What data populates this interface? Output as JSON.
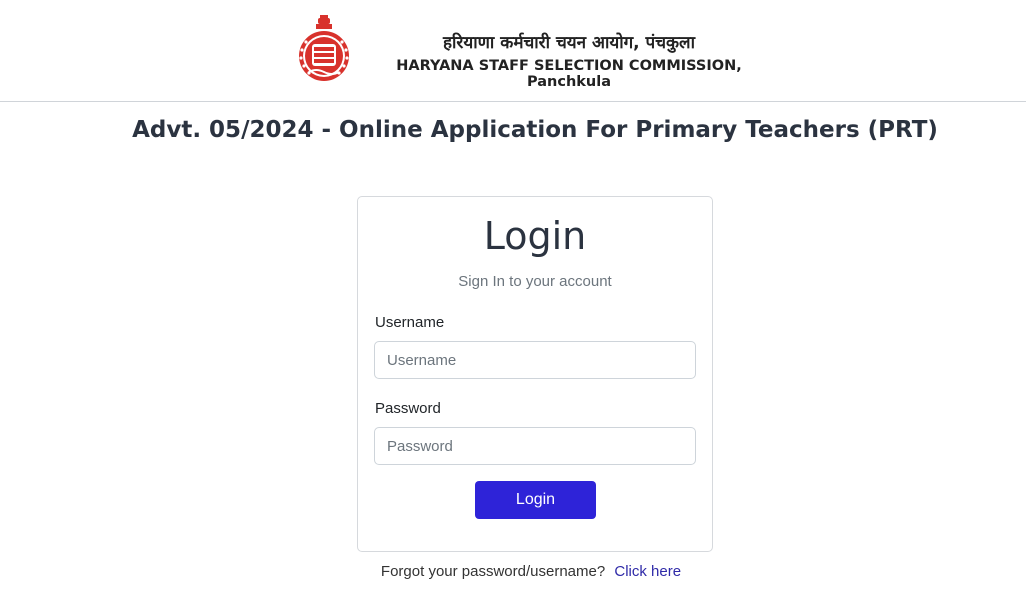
{
  "header": {
    "org_name_hindi": "हरियाणा कर्मचारी चयन आयोग, पंचकुला",
    "org_name_english": "HARYANA STAFF SELECTION COMMISSION, Panchkula",
    "emblem_icon": "haryana-emblem-icon"
  },
  "advertisement": {
    "title": "Advt. 05/2024 - Online Application For Primary Teachers (PRT)"
  },
  "login_card": {
    "title": "Login",
    "subtitle": "Sign In to your account",
    "username_label": "Username",
    "username_placeholder": "Username",
    "username_value": "",
    "password_label": "Password",
    "password_placeholder": "Password",
    "password_value": "",
    "submit_label": "Login"
  },
  "forgot": {
    "text": "Forgot your password/username?",
    "link_text": "Click here"
  },
  "colors": {
    "accent": "#2e23d8",
    "link": "#2f2aa8",
    "emblem": "#d8322c"
  }
}
